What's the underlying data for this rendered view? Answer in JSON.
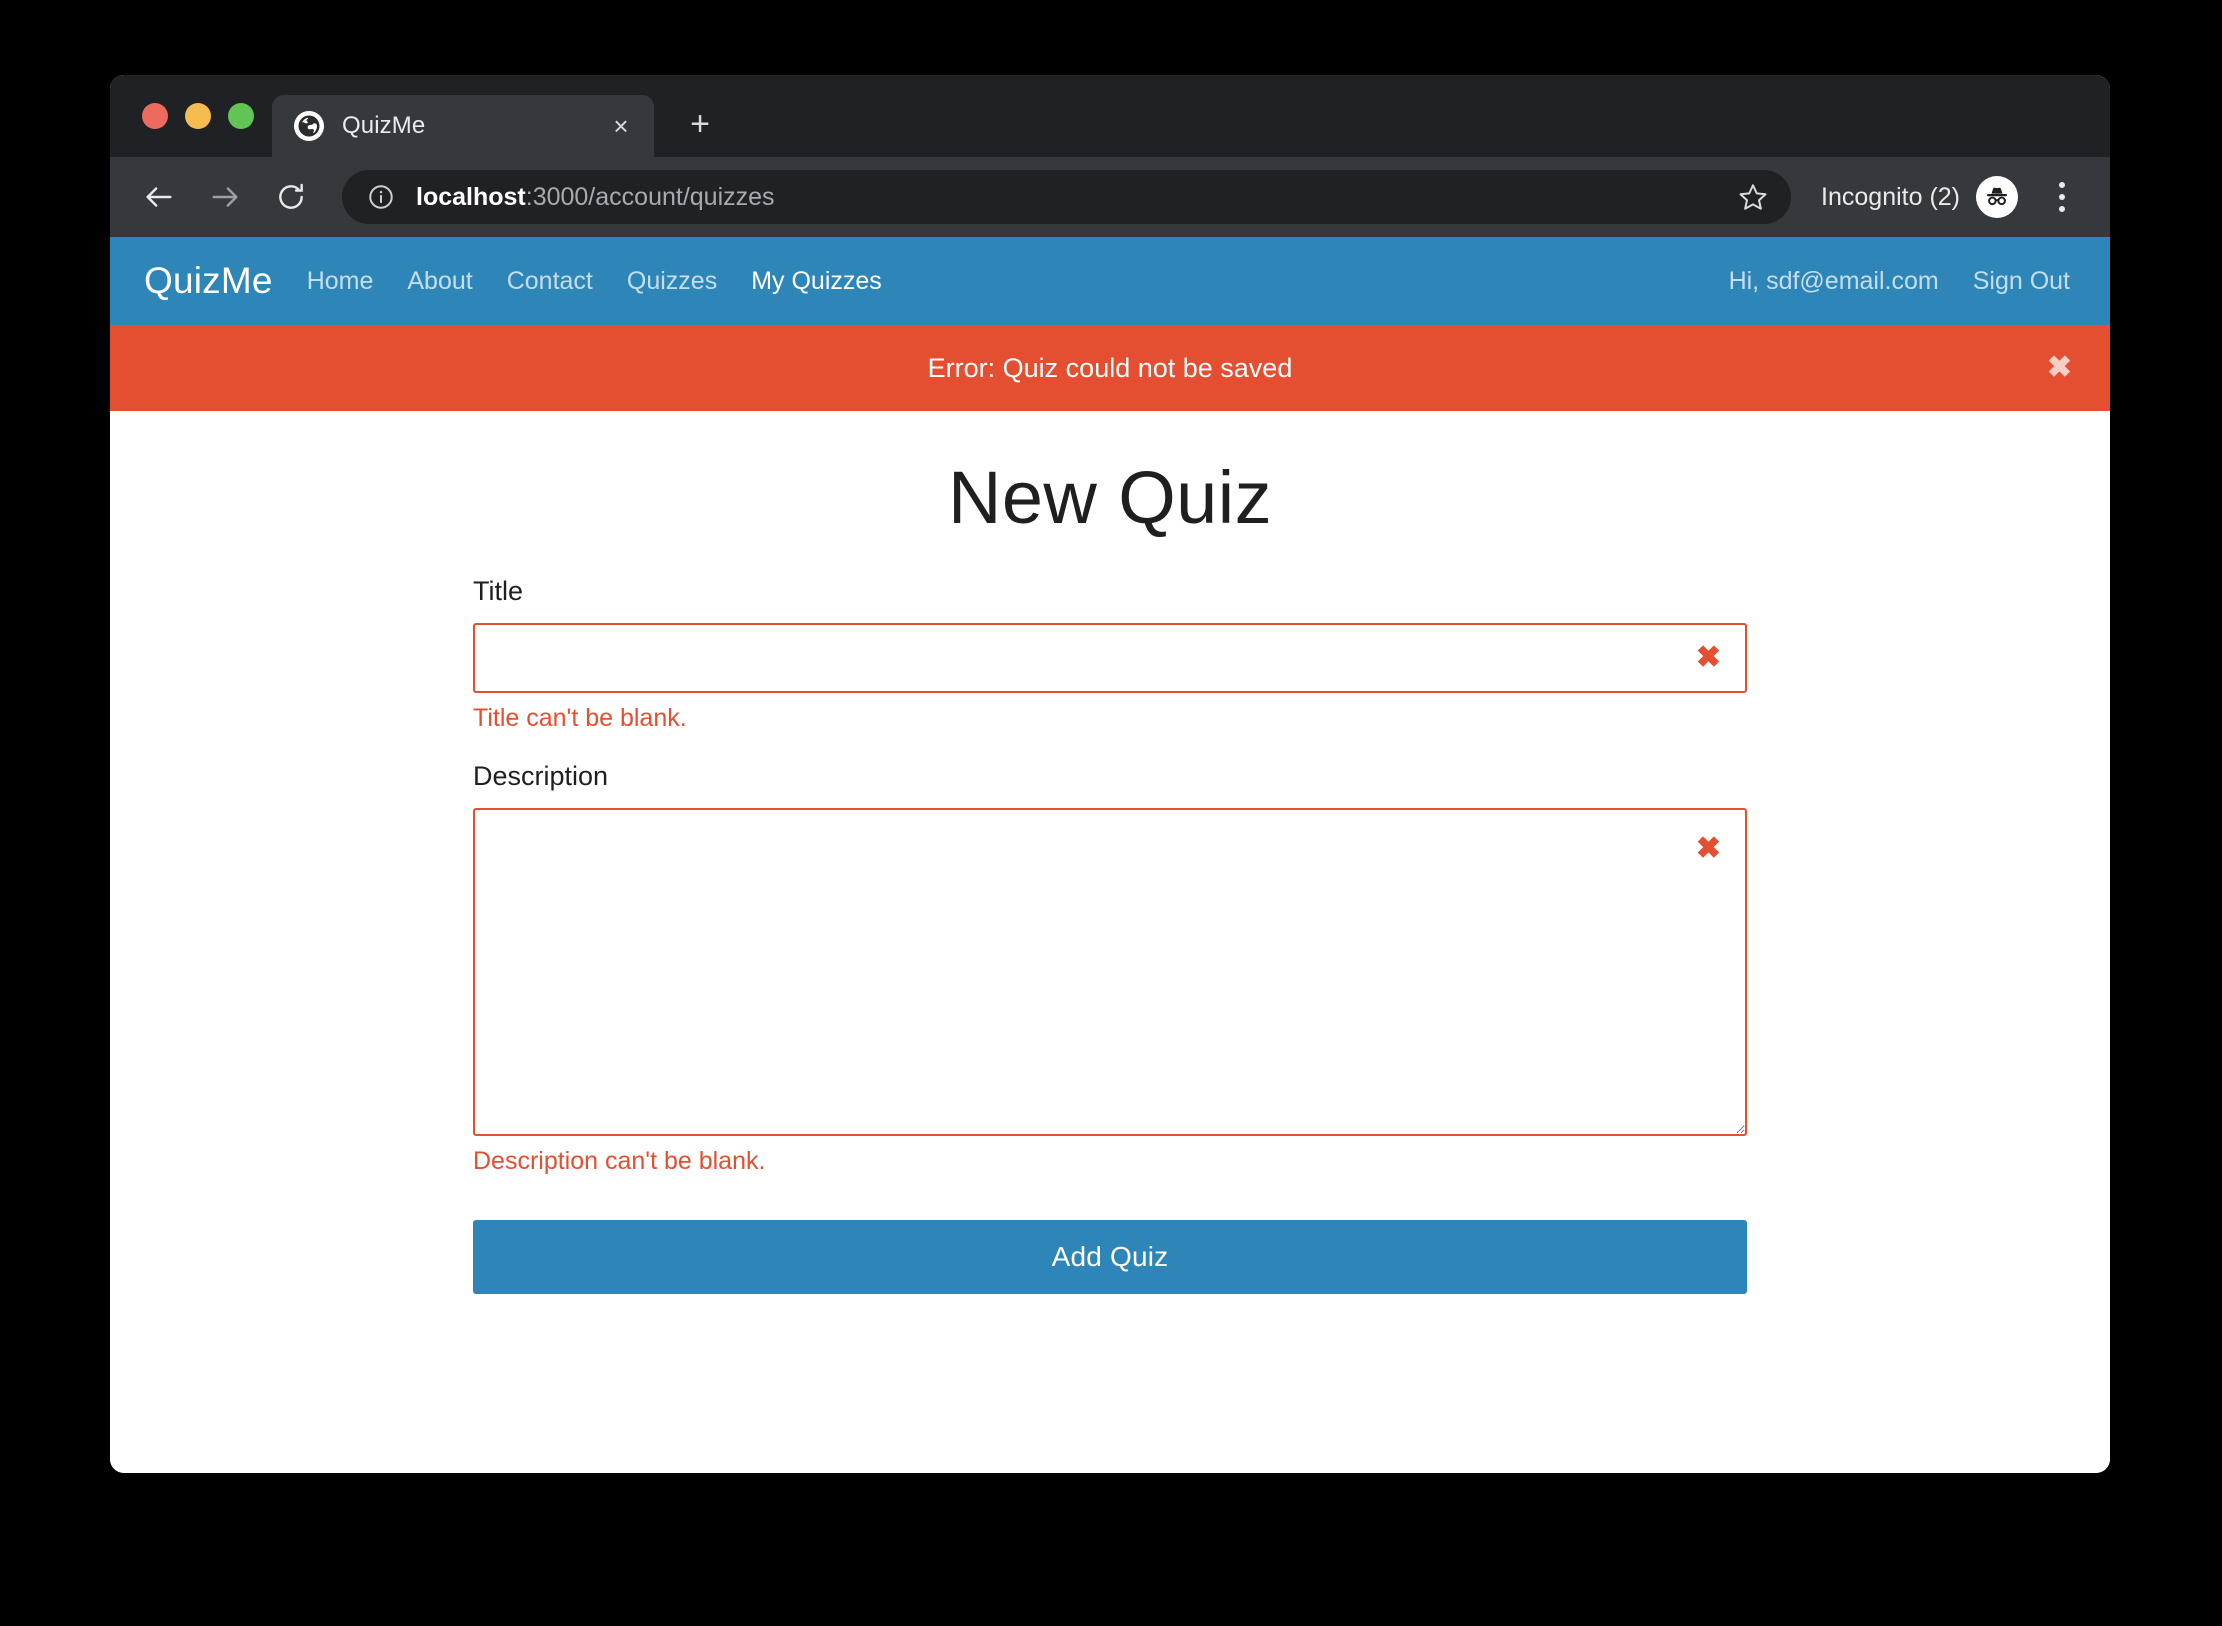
{
  "browser": {
    "tab": {
      "title": "QuizMe",
      "favicon_icon": "globe-icon",
      "close_icon": "×"
    },
    "new_tab_icon": "+",
    "toolbar": {
      "back_icon": "←",
      "forward_icon": "→",
      "reload_icon": "↻",
      "site_info_icon": "info-circle-icon",
      "url_host": "localhost",
      "url_path": ":3000/account/quizzes",
      "bookmark_icon": "star-outline-icon",
      "profile_label": "Incognito (2)",
      "profile_icon": "incognito-avatar-icon",
      "menu_icon": "three-dots-vertical-icon"
    },
    "traffic_lights": [
      {
        "name": "close",
        "color": "#ED6A5E"
      },
      {
        "name": "minimize",
        "color": "#F5BD4F"
      },
      {
        "name": "maximize",
        "color": "#61C454"
      }
    ]
  },
  "site": {
    "brand": "QuizMe",
    "nav_links": [
      {
        "label": "Home",
        "active": false
      },
      {
        "label": "About",
        "active": false
      },
      {
        "label": "Contact",
        "active": false
      },
      {
        "label": "Quizzes",
        "active": false
      },
      {
        "label": "My Quizzes",
        "active": true
      }
    ],
    "greeting": "Hi, sdf@email.com",
    "sign_out": "Sign Out"
  },
  "alert": {
    "message": "Error: Quiz could not be saved",
    "close_icon": "✖",
    "background": "#E54F31"
  },
  "page": {
    "title": "New Quiz"
  },
  "form": {
    "title_field": {
      "label": "Title",
      "value": "",
      "placeholder": "",
      "invalid_icon": "✖",
      "error": "Title can't be blank."
    },
    "description_field": {
      "label": "Description",
      "value": "",
      "placeholder": "",
      "invalid_icon": "✖",
      "error": "Description can't be blank."
    },
    "submit_label": "Add Quiz"
  },
  "colors": {
    "brand_blue": "#2E86B8",
    "error_red": "#E54F31",
    "page_background": "#FFFFFF",
    "chrome_dark": "#35393E",
    "tabstrip_dark": "#202124"
  }
}
